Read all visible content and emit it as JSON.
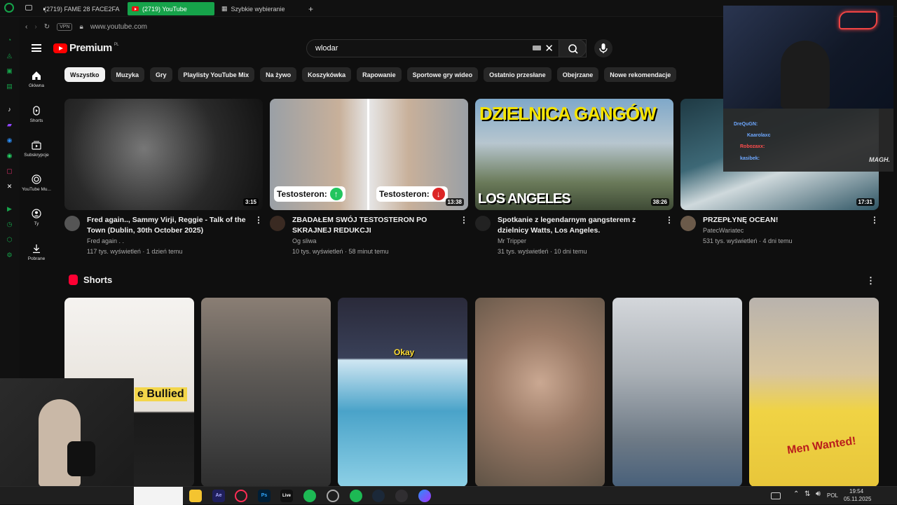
{
  "browser": {
    "tabs": [
      {
        "label": "(2719) FAME 28 FACE2FA"
      },
      {
        "label": "(2719) YouTube"
      },
      {
        "label": "Szybkie wybieranie"
      }
    ],
    "vpn_badge": "VPN",
    "url": "www.youtube.com"
  },
  "youtube": {
    "logo_text": "Premium",
    "logo_sup": "PL",
    "search_value": "wlodar",
    "nav": [
      {
        "label": "Główna"
      },
      {
        "label": "Shorts"
      },
      {
        "label": "Subskrypcje"
      },
      {
        "label": "YouTube Mu..."
      },
      {
        "label": "Ty"
      },
      {
        "label": "Pobrane"
      }
    ],
    "chips": [
      "Wszystko",
      "Muzyka",
      "Gry",
      "Playlisty YouTube Mix",
      "Na żywo",
      "Koszykówka",
      "Rapowanie",
      "Sportowe gry wideo",
      "Ostatnio przesłane",
      "Obejrzane",
      "Nowe rekomendacje"
    ],
    "videos": [
      {
        "title": "Fred again.., Sammy Virji, Reggie - Talk of the Town (Dublin, 30th October 2025)",
        "channel": "Fred again . .",
        "stats": "117 tys. wyświetleń · 1 dzień temu",
        "duration": "3:15",
        "thumb_color": "#3a3a3a"
      },
      {
        "title": "ZBADAŁEM SWÓJ TESTOSTERON PO SKRAJNEJ REDUKCJI",
        "channel": "Og sliwa",
        "stats": "10 tys. wyświetleń · 58 minut temu",
        "duration": "13:38",
        "thumb_color": "#8a8f96"
      },
      {
        "title": "Spotkanie z legendarnym gangsterem z dzielnicy Watts, Los Angeles.",
        "channel": "Mr Tripper",
        "stats": "31 tys. wyświetleń · 10 dni temu",
        "duration": "38:26",
        "thumb_color": "#5d7a8e"
      },
      {
        "title": "PRZEPŁYNĘ OCEAN!",
        "channel": "PatecWariatec",
        "stats": "531 tys. wyświetleń · 4 dni temu",
        "duration": "17:31",
        "thumb_color": "#2f5564"
      }
    ],
    "thumb_text": {
      "testosteron_left": "Testosteron:",
      "testosteron_right": "Testosteron:",
      "gang_title": "DZIELNICA GANGÓW",
      "gang_sub": "LOS ANGELES"
    },
    "shorts_title": "Shorts",
    "shorts": [
      {
        "overlay": "e Bullied",
        "color": "#e8e4df"
      },
      {
        "overlay": "",
        "color": "#6b6b6b"
      },
      {
        "overlay": "Okay",
        "color": "#3d6b8f"
      },
      {
        "overlay": "",
        "color": "#a89a83"
      },
      {
        "overlay": "",
        "color": "#9aa0a6"
      },
      {
        "overlay": "Men Wanted!",
        "color": "#e9c84a"
      }
    ]
  },
  "stream": {
    "chat": [
      {
        "user": "DreQuGN:",
        "color": "#6ea8ff"
      },
      {
        "user": "Kaarolaxc",
        "color": "#6ea8ff"
      },
      {
        "user": "Robozaxx:",
        "color": "#ff4d4d"
      },
      {
        "user": "kasibek:",
        "color": "#6ea8ff"
      }
    ],
    "cam_label": "MAGH."
  },
  "taskbar": {
    "lang": "POL",
    "time": "19:54",
    "date": "05.11.2025",
    "apps": [
      "Ae",
      "Ps",
      "Live"
    ]
  }
}
